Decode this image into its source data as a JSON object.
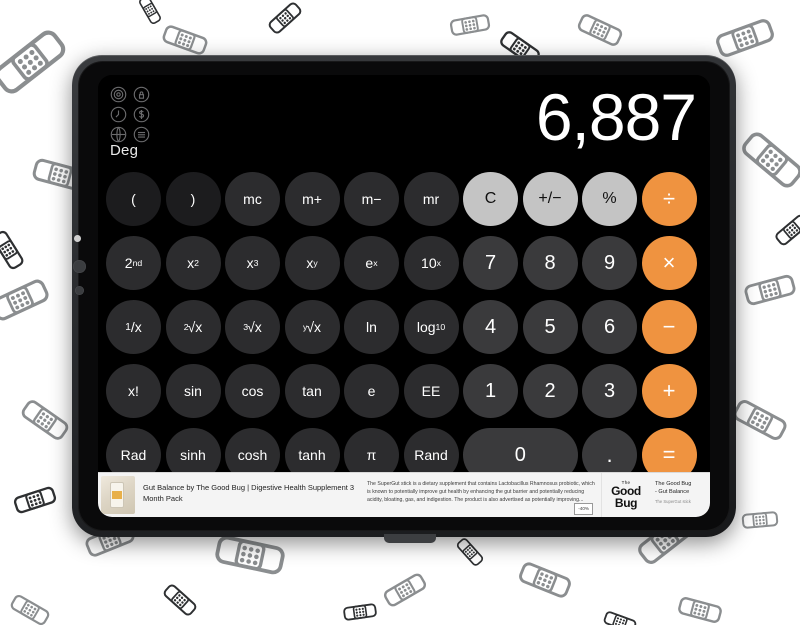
{
  "device": {
    "name": "tablet-device",
    "orientation": "landscape"
  },
  "app": {
    "name": "Calculator",
    "mode_label": "Deg",
    "display_value": "6,887",
    "widget_icons": [
      "gear-icon",
      "lock-icon",
      "clock-icon",
      "dollar-icon",
      "globe-icon",
      "menu-icon"
    ]
  },
  "keypad": {
    "rows": [
      [
        {
          "label": "(",
          "name": "key-open-paren",
          "style": "fn-dark"
        },
        {
          "label": ")",
          "name": "key-close-paren",
          "style": "fn-dark"
        },
        {
          "label": "mc",
          "name": "key-memory-clear",
          "style": "fn"
        },
        {
          "label": "m+",
          "name": "key-memory-add",
          "style": "fn"
        },
        {
          "label": "m−",
          "name": "key-memory-sub",
          "style": "fn"
        },
        {
          "label": "mr",
          "name": "key-memory-recall",
          "style": "fn"
        },
        {
          "label": "C",
          "name": "key-clear",
          "style": "util"
        },
        {
          "label": "+/−",
          "name": "key-sign-toggle",
          "style": "util"
        },
        {
          "label": "%",
          "name": "key-percent",
          "style": "util"
        },
        {
          "label": "÷",
          "name": "key-divide",
          "style": "op"
        }
      ],
      [
        {
          "label": "2nd",
          "name": "key-second",
          "style": "fn",
          "html": "2<span class=\"sup\">nd</span>"
        },
        {
          "label": "x²",
          "name": "key-square",
          "style": "fn",
          "html": "x<span class=\"sup\">2</span>"
        },
        {
          "label": "x³",
          "name": "key-cube",
          "style": "fn",
          "html": "x<span class=\"sup\">3</span>"
        },
        {
          "label": "xʸ",
          "name": "key-power-y",
          "style": "fn",
          "html": "x<span class=\"sup\">y</span>"
        },
        {
          "label": "eˣ",
          "name": "key-exp-e",
          "style": "fn",
          "html": "e<span class=\"sup\">x</span>"
        },
        {
          "label": "10ˣ",
          "name": "key-exp-ten",
          "style": "fn",
          "html": "10<span class=\"sup\">x</span>"
        },
        {
          "label": "7",
          "name": "key-7",
          "style": "digit"
        },
        {
          "label": "8",
          "name": "key-8",
          "style": "digit"
        },
        {
          "label": "9",
          "name": "key-9",
          "style": "digit"
        },
        {
          "label": "×",
          "name": "key-multiply",
          "style": "op"
        }
      ],
      [
        {
          "label": "1/x",
          "name": "key-reciprocal",
          "style": "fn",
          "html": "<span class=\"frac-small\">1</span>/x"
        },
        {
          "label": "²√x",
          "name": "key-sqrt",
          "style": "fn",
          "html": "<span class=\"pre\">2</span>√x"
        },
        {
          "label": "³√x",
          "name": "key-cbrt",
          "style": "fn",
          "html": "<span class=\"pre\">3</span>√x"
        },
        {
          "label": "ʸ√x",
          "name": "key-root-y",
          "style": "fn",
          "html": "<span class=\"pre\">y</span>√x"
        },
        {
          "label": "ln",
          "name": "key-ln",
          "style": "fn"
        },
        {
          "label": "log10",
          "name": "key-log10",
          "style": "fn",
          "html": "log<span class=\"sub\">10</span>"
        },
        {
          "label": "4",
          "name": "key-4",
          "style": "digit"
        },
        {
          "label": "5",
          "name": "key-5",
          "style": "digit"
        },
        {
          "label": "6",
          "name": "key-6",
          "style": "digit"
        },
        {
          "label": "−",
          "name": "key-subtract",
          "style": "op"
        }
      ],
      [
        {
          "label": "x!",
          "name": "key-factorial",
          "style": "fn"
        },
        {
          "label": "sin",
          "name": "key-sin",
          "style": "fn"
        },
        {
          "label": "cos",
          "name": "key-cos",
          "style": "fn"
        },
        {
          "label": "tan",
          "name": "key-tan",
          "style": "fn"
        },
        {
          "label": "e",
          "name": "key-euler",
          "style": "fn"
        },
        {
          "label": "EE",
          "name": "key-ee",
          "style": "fn"
        },
        {
          "label": "1",
          "name": "key-1",
          "style": "digit"
        },
        {
          "label": "2",
          "name": "key-2",
          "style": "digit"
        },
        {
          "label": "3",
          "name": "key-3",
          "style": "digit"
        },
        {
          "label": "+",
          "name": "key-add",
          "style": "op"
        }
      ],
      [
        {
          "label": "Rad",
          "name": "key-rad",
          "style": "fn"
        },
        {
          "label": "sinh",
          "name": "key-sinh",
          "style": "fn"
        },
        {
          "label": "cosh",
          "name": "key-cosh",
          "style": "fn"
        },
        {
          "label": "tanh",
          "name": "key-tanh",
          "style": "fn"
        },
        {
          "label": "π",
          "name": "key-pi",
          "style": "fn"
        },
        {
          "label": "Rand",
          "name": "key-rand",
          "style": "fn"
        },
        {
          "label": "0",
          "name": "key-0",
          "style": "digit zero"
        },
        {
          "label": ".",
          "name": "key-decimal",
          "style": "digit dot"
        },
        {
          "label": "=",
          "name": "key-equals",
          "style": "op"
        }
      ]
    ]
  },
  "ad": {
    "title": "Gut Balance by The Good Bug | Digestive Health Supplement 3 Month Pack",
    "description": "The SuperGut stick is a dietary supplement that contains Lactobacillus Rhamnosus probiotic, which is known to potentially improve gut health by enhancing the gut barrier and potentially reducing acidity, bloating, gas, and indigestion. The product is also advertised as potentially improving...",
    "discount_badge": "-40%",
    "logo_the": "The",
    "logo_good": "Good",
    "logo_bug": "Bug",
    "brand_line1": "The Good Bug",
    "brand_line2": "- Gut Balance",
    "brand_sub": "The SuperGut stick"
  },
  "colors": {
    "accent_orange": "#ef9340",
    "util_gray": "#c4c4c4",
    "digit_gray": "#3a3a3c",
    "fn_gray": "#2c2c2e",
    "screen_black": "#000000"
  }
}
